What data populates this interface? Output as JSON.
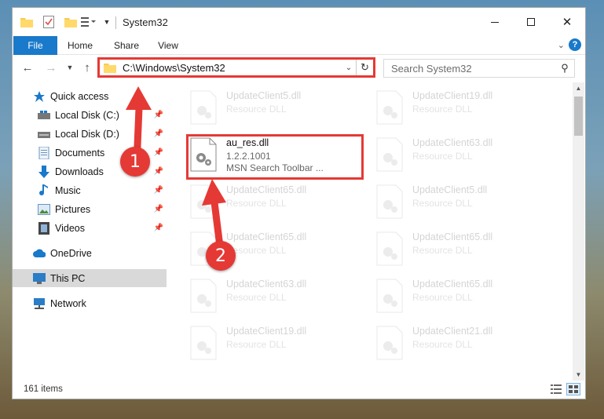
{
  "window": {
    "title": "System32"
  },
  "ribbon": {
    "tabs": [
      "File",
      "Home",
      "Share",
      "View"
    ]
  },
  "navbar": {
    "address": "C:\\Windows\\System32",
    "search_placeholder": "Search System32"
  },
  "sidebar": {
    "items": [
      {
        "label": "Quick access",
        "icon": "star-icon"
      },
      {
        "label": "Local Disk (C:)",
        "icon": "drive-icon"
      },
      {
        "label": "Local Disk (D:)",
        "icon": "drive-icon"
      },
      {
        "label": "Documents",
        "icon": "documents-icon"
      },
      {
        "label": "Downloads",
        "icon": "download-icon"
      },
      {
        "label": "Music",
        "icon": "music-icon"
      },
      {
        "label": "Pictures",
        "icon": "pictures-icon"
      },
      {
        "label": "Videos",
        "icon": "videos-icon"
      },
      {
        "label": "OneDrive",
        "icon": "cloud-icon"
      },
      {
        "label": "This PC",
        "icon": "computer-icon"
      },
      {
        "label": "Network",
        "icon": "network-icon"
      }
    ]
  },
  "files": {
    "highlighted": {
      "name": "au_res.dll",
      "version": "1.2.2.1001",
      "desc": "MSN Search Toolbar ..."
    },
    "left": [
      {
        "name": "UpdateClient5.dll",
        "desc": "Resource DLL"
      },
      {
        "name": "UpdateClient65.dll",
        "desc": "Resource DLL"
      },
      {
        "name": "UpdateClient65.dll",
        "desc": "Resource DLL"
      },
      {
        "name": "UpdateClient63.dll",
        "desc": "Resource DLL"
      },
      {
        "name": "UpdateClient19.dll",
        "desc": "Resource DLL"
      }
    ],
    "right": [
      {
        "name": "UpdateClient19.dll",
        "desc": "Resource DLL"
      },
      {
        "name": "UpdateClient63.dll",
        "desc": "Resource DLL"
      },
      {
        "name": "UpdateClient5.dll",
        "desc": "Resource DLL"
      },
      {
        "name": "UpdateClient65.dll",
        "desc": "Resource DLL"
      },
      {
        "name": "UpdateClient65.dll",
        "desc": "Resource DLL"
      },
      {
        "name": "UpdateClient21.dll",
        "desc": "Resource DLL"
      }
    ]
  },
  "status": {
    "item_count": "161 items"
  },
  "callouts": {
    "one": "1",
    "two": "2"
  },
  "colors": {
    "accent": "#1979ca",
    "highlight": "#e53935"
  }
}
